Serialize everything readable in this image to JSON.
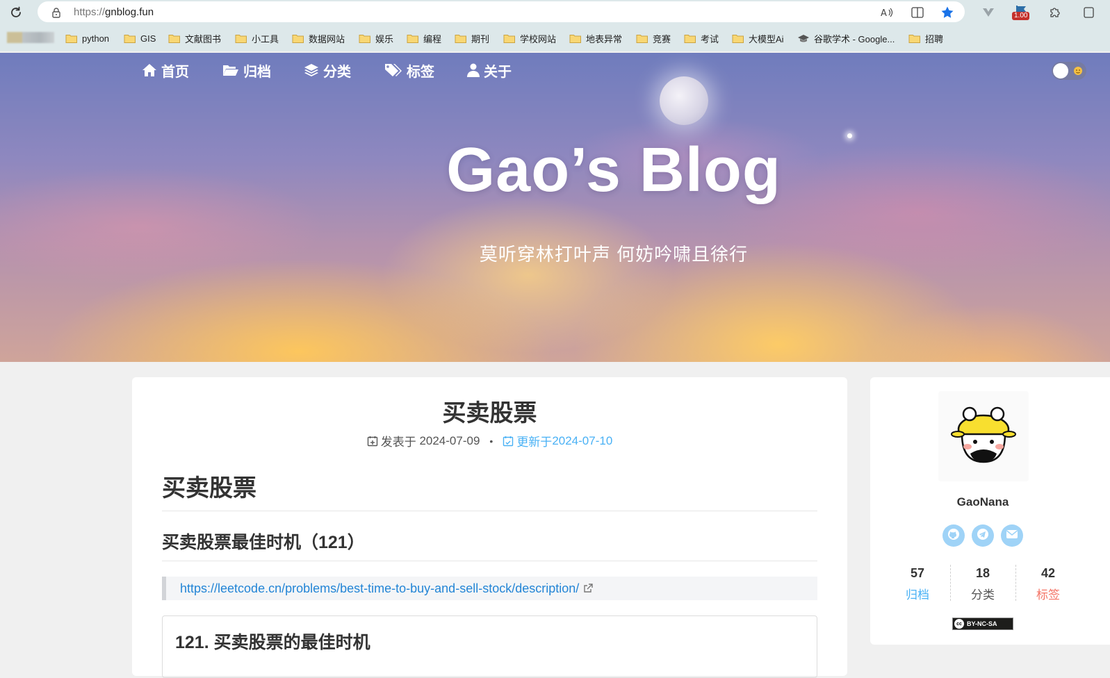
{
  "browser": {
    "url_scheme": "https://",
    "url_host": "gnblog.fun",
    "extension_badge": "1.00",
    "bookmarks": [
      "python",
      "GIS",
      "文献图书",
      "小工具",
      "数据网站",
      "娱乐",
      "编程",
      "期刊",
      "学校网站",
      "地表异常",
      "竞赛",
      "考试",
      "大模型Ai",
      "谷歌学术 - Google...",
      "招聘"
    ]
  },
  "nav": {
    "items": [
      {
        "label": "首页",
        "icon": "home-icon"
      },
      {
        "label": "归档",
        "icon": "folder-open-icon"
      },
      {
        "label": "分类",
        "icon": "layers-icon"
      },
      {
        "label": "标签",
        "icon": "tags-icon"
      },
      {
        "label": "关于",
        "icon": "user-icon"
      }
    ]
  },
  "hero": {
    "title": "Gao’s Blog",
    "subtitle": "莫听穿林打叶声 何妨吟啸且徐行"
  },
  "post": {
    "title": "买卖股票",
    "published_label": "发表于",
    "published_date": "2024-07-09",
    "updated_label": "更新于",
    "updated_date": "2024-07-10",
    "separator": "•",
    "heading1": "买卖股票",
    "heading2": "买卖股票最佳时机（121）",
    "link": "https://leetcode.cn/problems/best-time-to-buy-and-sell-stock/description/",
    "problem_title": "121. 买卖股票的最佳时机"
  },
  "sidebar": {
    "author": "GaoNana",
    "social_icons": [
      "github-icon",
      "telegram-icon",
      "email-icon"
    ],
    "stats": [
      {
        "num": "57",
        "label": "归档",
        "color": "#49b1f5"
      },
      {
        "num": "18",
        "label": "分类",
        "color": "#555555"
      },
      {
        "num": "42",
        "label": "标签",
        "color": "#f47466"
      }
    ],
    "license": "BY-NC-SA",
    "license_logo": "cc"
  },
  "colors": {
    "accent": "#49b1f5",
    "link": "#2385d6",
    "tag_accent": "#f47466"
  }
}
